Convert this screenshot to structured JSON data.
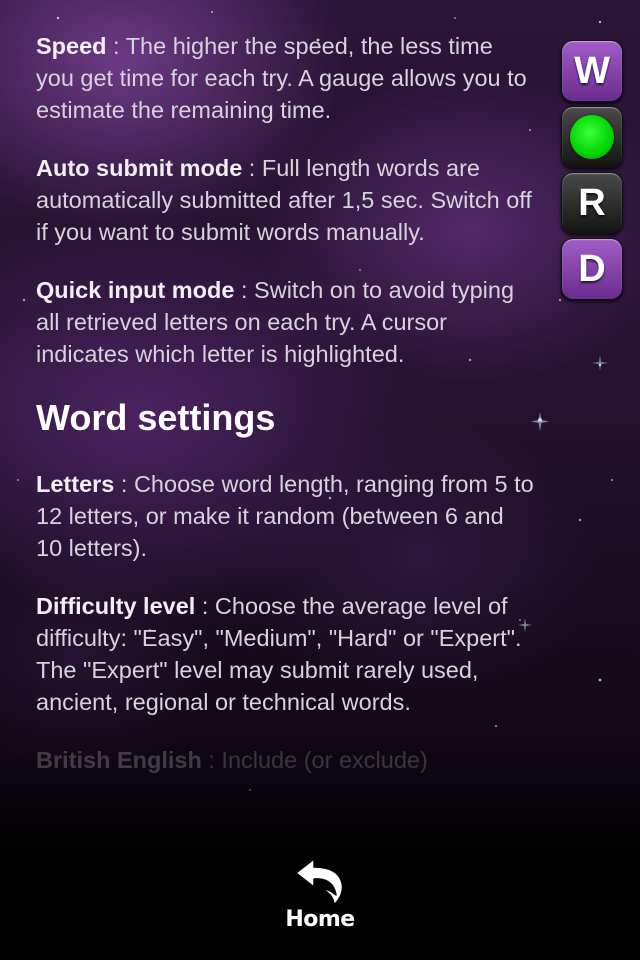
{
  "paragraphs_top": [
    {
      "term": "Speed",
      "text": " : The higher the speed, the less time you get time for each try. A gauge allows you to estimate the remaining time."
    },
    {
      "term": "Auto submit mode",
      "text": " : Full length words are automatically submitted after 1,5 sec. Switch off if you want to submit words manually."
    },
    {
      "term": "Quick input mode",
      "text": " : Switch on to avoid typing all retrieved letters on each try. A cursor indicates which letter is highlighted."
    }
  ],
  "section_heading": "Word settings",
  "paragraphs_bottom": [
    {
      "term": "Letters",
      "text": " : Choose word length, ranging from 5 to 12 letters, or make it random (between 6 and 10 letters)."
    },
    {
      "term": "Difficulty level",
      "text": " : Choose the average level of difficulty: \"Easy\", \"Medium\", \"Hard\" or \"Expert\". The \"Expert\" level may submit rarely used, ancient, regional or technical words."
    },
    {
      "term": "British English",
      "text": " : Include (or exclude)"
    }
  ],
  "logo": {
    "tiles": [
      "W",
      "",
      "R",
      "D"
    ],
    "tile_colors": [
      "#8e46b4",
      "#2a2a2a",
      "#2a2a2a",
      "#8e46b4"
    ],
    "dot_color": "#00e000"
  },
  "nav": {
    "home_label": "Home",
    "home_icon": "back-arrow-icon"
  }
}
